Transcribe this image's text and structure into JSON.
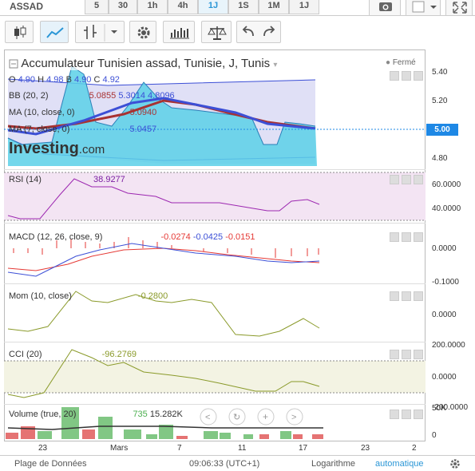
{
  "symbol": "ASSAD",
  "timeframes": [
    "5",
    "30",
    "1h",
    "4h",
    "1J",
    "1S",
    "1M",
    "1J"
  ],
  "active_timeframe": "1J",
  "title": "Accumulateur Tunisien assad, Tunisie, J, Tunis",
  "status": "Fermé",
  "ohlc": {
    "o_label": "O",
    "o": "4.90",
    "h_label": "H",
    "h": "4.98",
    "b_label": "B",
    "b": "4.90",
    "c_label": "C",
    "c": "4.92"
  },
  "bb": {
    "label": "BB (20, 2)",
    "v1": "5.0855",
    "v2": "5.3014",
    "v3": "4.8096"
  },
  "ma1": {
    "label": "MA (10, close, 0)",
    "value": "5.0940"
  },
  "ma2": {
    "label": "MA (7, close, 0)",
    "value": "5.0457"
  },
  "watermark": "Investing",
  "watermark_suffix": ".com",
  "price_axis": [
    "5.40",
    "5.20",
    "5.00",
    "4.80"
  ],
  "current_price": "5.00",
  "rsi": {
    "label": "RSI (14)",
    "value": "38.9277",
    "axis": [
      "60.0000",
      "40.0000"
    ]
  },
  "macd": {
    "label": "MACD (12, 26, close, 9)",
    "v1": "-0.0274",
    "v2": "-0.0425",
    "v3": "-0.0151",
    "axis": [
      "0.0000",
      "-0.1000"
    ]
  },
  "mom": {
    "label": "Mom (10, close)",
    "value": "-0.2800",
    "axis": [
      "0.0000"
    ]
  },
  "cci": {
    "label": "CCI (20)",
    "value": "-96.2769",
    "axis": [
      "200.0000",
      "0.0000",
      "-200.0000"
    ]
  },
  "volume": {
    "label": "Volume (true, 20)",
    "v1": "735",
    "v2": "15.282K",
    "axis": [
      "50K",
      "0"
    ]
  },
  "x_labels": [
    "23",
    "Mars",
    "7",
    "11",
    "17",
    "23",
    "2"
  ],
  "bottom": {
    "data_range": "Plage de Données",
    "time": "09:06:33 (UTC+1)",
    "log": "Logarithme",
    "auto": "automatique"
  },
  "colors": {
    "accent": "#2a96d6",
    "bb_fill": "#ccccf0",
    "candle_fill": "#5ad0e8",
    "rsi_fill": "#f3e4f3",
    "cci_fill": "#f3f3e3",
    "ma_red": "#a83232",
    "ma_blue": "#3c4fd6"
  }
}
